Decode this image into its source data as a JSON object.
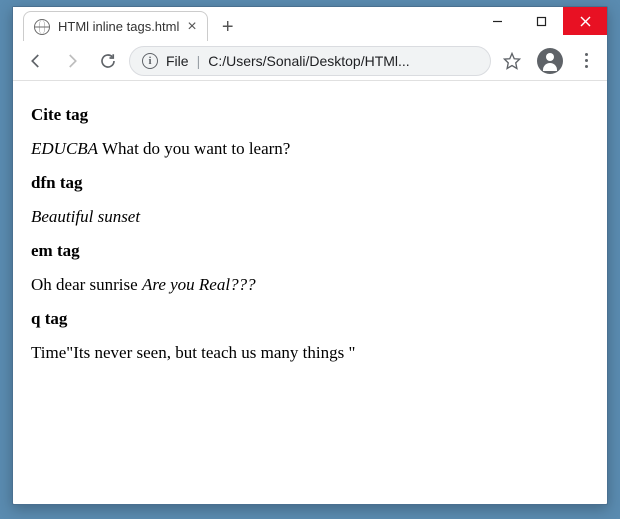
{
  "tab": {
    "title": "HTMl inline tags.html"
  },
  "address": {
    "prefix": "File",
    "path": "C:/Users/Sonali/Desktop/HTMl..."
  },
  "sections": {
    "cite": {
      "heading": "Cite tag",
      "cited": "EDUCBA",
      "rest": "  What do you want to learn?"
    },
    "dfn": {
      "heading": "dfn tag",
      "text": "Beautiful sunset"
    },
    "em": {
      "heading": "em tag",
      "plain": "Oh dear sunrise  ",
      "emph": "Are you Real???"
    },
    "q": {
      "heading": "q tag",
      "lead": "Time",
      "quote": "Its never seen, but teach us many things "
    }
  }
}
